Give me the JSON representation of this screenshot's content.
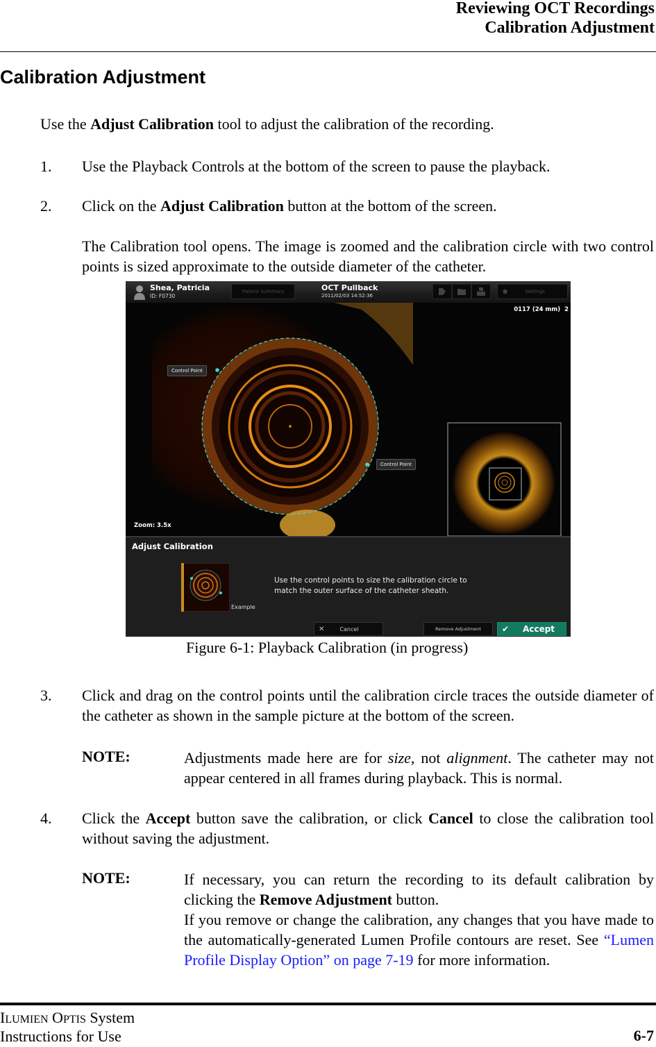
{
  "header": {
    "chapter": "Reviewing OCT Recordings",
    "section": "Calibration Adjustment"
  },
  "title": "Calibration Adjustment",
  "intro": {
    "pre": "Use the ",
    "bold": "Adjust Calibration",
    "post": " tool to adjust the calibration of the recording."
  },
  "steps": [
    {
      "num": "1.",
      "text": "Use the Playback Controls at the bottom of the screen to pause the playback."
    },
    {
      "num": "2.",
      "pre": "Click on the ",
      "bold": "Adjust Calibration",
      "post": " button at the bottom of the screen."
    },
    {
      "num": "3.",
      "text": "Click and drag on the control points until the calibration circle traces the outside diameter of the catheter as shown in the sample picture at the bottom of the screen."
    },
    {
      "num": "4.",
      "pre": "Click the ",
      "bold": "Accept",
      "mid": " button save the calibration, or click ",
      "bold2": "Cancel",
      "post": " to close the calibration tool without saving the adjustment."
    }
  ],
  "step2_followup": "The Calibration tool opens. The image is zoomed and the calibration circle with two control points is sized approximate to the outside diameter of the catheter.",
  "figure": {
    "caption": "Figure 6-1:  Playback Calibration (in progress)",
    "app": {
      "patient_name": "Shea, Patricia",
      "patient_id": "ID: F0730",
      "patient_summary_tab": "Patient Summary",
      "recording_title": "OCT Pullback",
      "recording_datetime": "2011/02/03 14:52:36",
      "settings_label": "Settings",
      "frame_info": "0117 (24 mm)  2",
      "zoom_label": "Zoom: 3.5x",
      "control_point_label": "Control Point",
      "panel_title": "Adjust Calibration",
      "instructions_line1": "Use the control points to size the calibration circle to",
      "instructions_line2": "match the outer surface of the catheter sheath.",
      "example_label": "Example",
      "cancel_label": "Cancel",
      "remove_label": "Remove Adjustment",
      "accept_label": "Accept",
      "accent_color": "#137a61",
      "control_point_color": "#3fd6d0"
    }
  },
  "note1": {
    "label": "NOTE:",
    "pre": "Adjustments made here are for ",
    "it1": "size",
    "mid": ", not ",
    "it2": "alignment",
    "post": ". The catheter may not appear centered in all frames during playback. This is normal."
  },
  "note2": {
    "label": "NOTE:",
    "pre": "If necessary, you can return the recording to its default calibration by clicking the ",
    "bold": "Remove Adjustment",
    "post": " button.",
    "para2_pre": "If you remove or change the calibration, any changes that you have made to the automatically-generated Lumen Profile contours are reset. See ",
    "link": "“Lumen Profile Display Option” on page 7-19",
    "para2_post": " for more information."
  },
  "footer": {
    "product_I": "I",
    "product_LUMIEN": "LUMIEN",
    "product_O": "O",
    "product_PTIS": "PTIS",
    "product_system": " System",
    "doc": "Instructions for Use",
    "page": "6-7"
  }
}
